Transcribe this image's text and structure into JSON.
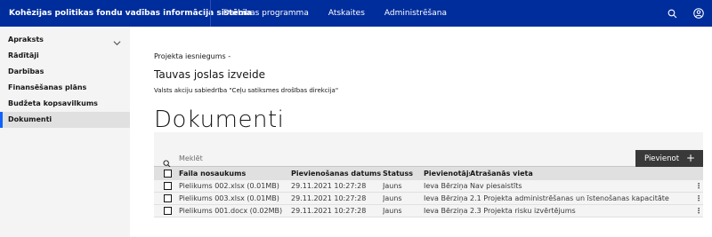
{
  "header": {
    "app_title": "Kohēzijas politikas fondu vadības informācija sistēma",
    "nav": [
      "Darbības programma",
      "Atskaites",
      "Administrēšana"
    ],
    "icons": [
      "search-icon",
      "user-icon"
    ],
    "bg_color": "#002d9c"
  },
  "sidebar": {
    "items": [
      {
        "label": "Apraksts",
        "icon": "chevron-down-icon"
      },
      {
        "label": "Rādītāji"
      },
      {
        "label": "Darbības"
      },
      {
        "label": "Finansēšanas plāns"
      },
      {
        "label": "Budžeta kopsavilkums"
      },
      {
        "label": "Dokumenti",
        "active": true
      }
    ],
    "accent_color": "#0f62fe"
  },
  "main": {
    "breadcrumb": "Projekta iesniegums -",
    "project_title": "Tauvas joslas izveide",
    "organization": "Valsts akciju sabiedrība \"Ceļu satiksmes drošības direkcija\"",
    "page_title": "Dokumenti",
    "search": {
      "placeholder": "Meklēt"
    },
    "add_button": {
      "label": "Pievienot",
      "icon": "plus-icon"
    },
    "table": {
      "headers": [
        "Faila nosaukums",
        "Pievienošanas datums",
        "Statuss",
        "Pievienotājs",
        "Atrašanās vieta"
      ],
      "rows": [
        [
          "Pielikums 002.xlsx (0.01MB)",
          "29.11.2021 10:27:28",
          "Jauns",
          "Ieva Bērziņa",
          "Nav piesaistīts"
        ],
        [
          "Pielikums 003.xlsx (0.01MB)",
          "29.11.2021 10:27:28",
          "Jauns",
          "Ieva Bērziņa",
          "2.1 Projekta administrēšanas un īstenošanas kapacitāte"
        ],
        [
          "Pielikums 001.docx (0.02MB)",
          "29.11.2021 10:27:28",
          "Jauns",
          "Ieva Bērziņa",
          "2.3 Projekta risku izvērtējums"
        ]
      ]
    }
  }
}
